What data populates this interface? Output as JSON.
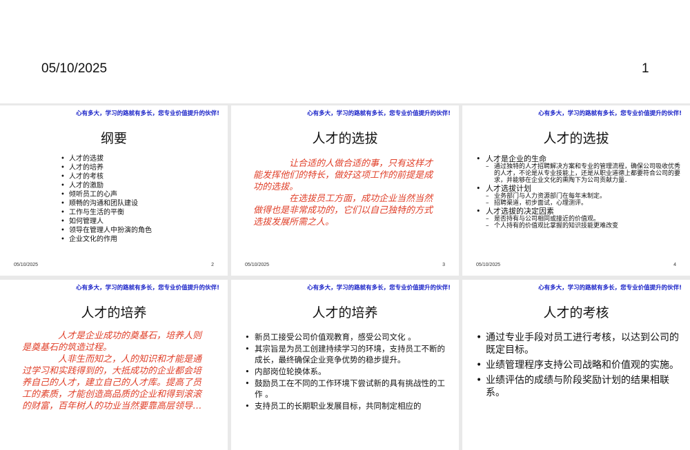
{
  "header": {
    "date": "05/10/2025",
    "page_number": "1"
  },
  "motto": "心有多大，学习的路就有多长，您专业价值提升的伙伴!",
  "slides": [
    {
      "title": "纲要",
      "items": [
        "人才的选拔",
        "人才的培养",
        "人才的考核",
        "人才的激励",
        "倾听员工的心声",
        "顺畅的沟通和团队建设",
        "工作与生活的平衡",
        "如何管理人",
        "领导在管理人中扮演的角色",
        "企业文化的作用"
      ],
      "footer_date": "05/10/2025",
      "footer_num": "2"
    },
    {
      "title": "人才的选拔",
      "paragraphs": [
        "　　　　让合适的人做合适的事，只有这样才能发挥他们的特长，做好这项工作的前提是成功的选拔。",
        "　　　　在选拔员工方面，成功企业当然当然做得也是非常成功的，它们以自己独特的方式选拔发展所需之人。"
      ],
      "footer_date": "05/10/2025",
      "footer_num": "3"
    },
    {
      "title": "人才的选拔",
      "items": [
        {
          "text": "人才是企业的生命",
          "sub": [
            "通过独特的人才招聘解决方案和专业的管理流程，确保公司吸收优秀的人才，不论是从专业技能上，还是从职业道德上都要符合公司的要求，并能够在企业文化的熏陶下为公司贡献力量．"
          ]
        },
        {
          "text": "人才选拔计划",
          "sub": [
            "业务部门与人力资源部门在每年末制定。",
            "招聘渠道，初步面试，心理测评。"
          ]
        },
        {
          "text": "人才选拔的决定因素",
          "sub": [
            "是否持有与公司相同或接近的价值观。",
            "个人持有的价值观比掌握的知识技能更难改变"
          ]
        }
      ],
      "footer_date": "05/10/2025",
      "footer_num": "4"
    },
    {
      "title": "人才的培养",
      "paragraphs": [
        "　　　　人才是企业成功的奠基石，培养人则是奠基石的筑造过程。",
        "　　　　人非生而知之，人的知识和才能是通过学习和实践得到的，大抵成功的企业都会培养自己的人才，建立自己的人才库。提高了员工的素质，才能创造高品质的企业和得到滚滚的财富，百年树人的功业当然要靠高层领导…"
      ]
    },
    {
      "title": "人才的培养",
      "items": [
        "新员工接受公司价值观教育，感受公司文化 。",
        "其宗旨是为员工创建持续学习的环境，支持员工不断的成长，最终确保企业竞争优势的稳步提升。",
        "内部岗位轮换体系。",
        "鼓励员工在不同的工作环境下尝试新的具有挑战性的工作 。",
        "支持员工的长期职业发展目标，共同制定相应的"
      ]
    },
    {
      "title": "人才的考核",
      "items": [
        "通过专业手段对员工进行考核，以达到公司的既定目标。",
        "业绩管理程序支持公司战略和价值观的实施。",
        "业绩评估的成绩与阶段奖励计划的结果相联系。"
      ]
    }
  ]
}
